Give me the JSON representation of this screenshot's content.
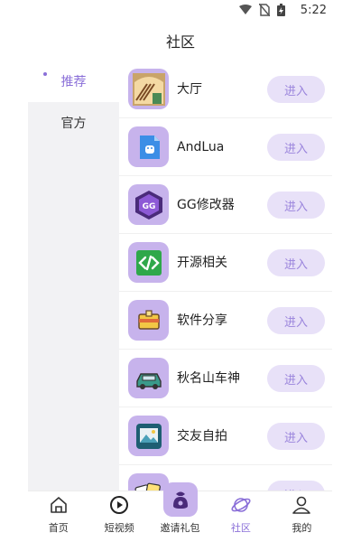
{
  "status": {
    "time": "5:22",
    "icons": [
      "wifi-icon",
      "no-sim-icon",
      "battery-icon"
    ]
  },
  "title": "社区",
  "sidebar": {
    "items": [
      {
        "label": "推荐",
        "active": true
      },
      {
        "label": "官方",
        "active": false
      }
    ]
  },
  "list": {
    "enter_label": "进入",
    "items": [
      {
        "name": "大厅",
        "icon": "hall-icon"
      },
      {
        "name": "AndLua",
        "icon": "andlua-icon"
      },
      {
        "name": "GG修改器",
        "icon": "gg-icon"
      },
      {
        "name": "开源相关",
        "icon": "code-icon"
      },
      {
        "name": "软件分享",
        "icon": "share-icon"
      },
      {
        "name": "秋名山车神",
        "icon": "car-icon"
      },
      {
        "name": "交友自拍",
        "icon": "photo-icon"
      },
      {
        "name": "",
        "icon": "cards-icon"
      }
    ]
  },
  "tabbar": {
    "tabs": [
      {
        "label": "首页",
        "icon": "home-icon"
      },
      {
        "label": "短视频",
        "icon": "play-icon"
      },
      {
        "label": "邀请礼包",
        "icon": "gift-icon"
      },
      {
        "label": "社区",
        "icon": "planet-icon",
        "active": true
      },
      {
        "label": "我的",
        "icon": "user-icon"
      }
    ]
  },
  "colors": {
    "accent": "#8a6fd8",
    "icon_bg": "#c7b3ec",
    "button_bg": "#e8e1f8",
    "sidebar_bg": "#f2f2f4"
  }
}
